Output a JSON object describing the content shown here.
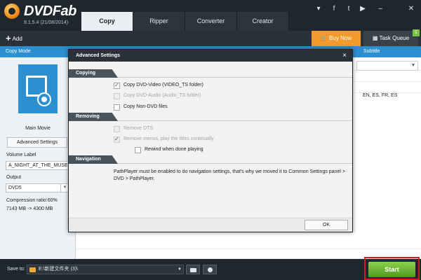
{
  "app": {
    "logo_text": "DVDFab",
    "version": "9.1.5.4 (21/08/2014)"
  },
  "window_icons": [
    "dropdown-icon",
    "facebook-icon",
    "twitter-icon",
    "youtube-icon",
    "minimize-icon",
    "close-icon"
  ],
  "tabs": [
    {
      "label": "Copy",
      "active": true
    },
    {
      "label": "Ripper",
      "active": false
    },
    {
      "label": "Converter",
      "active": false
    },
    {
      "label": "Creator",
      "active": false
    }
  ],
  "toolbar": {
    "add_label": "Add",
    "buy_now_label": "Buy Now",
    "task_queue_label": "Task Queue",
    "task_queue_count": "1"
  },
  "header": {
    "copy_mode_label": "Copy Mode",
    "subtitle_label": "Subtitle"
  },
  "left_panel": {
    "mode_name": "Main Movie",
    "advanced_settings_label": "Advanced Settings",
    "volume_label_title": "Volume Label",
    "volume_label_value": "A_NIGHT_AT_THE_MUSE",
    "output_title": "Output",
    "output_value": "DVD5",
    "compression_ratio": "Compression ratio:60%",
    "size_info": "7143 MB -> 4300 MB"
  },
  "content": {
    "subtitle_value": "EN, ES, FR, ES"
  },
  "bottom": {
    "save_to_label": "Save to:",
    "save_to_path": "E:\\新建文件夹 (3)\\",
    "start_label": "Start"
  },
  "modal": {
    "title": "Advanced Settings",
    "close_label": "×",
    "sections": {
      "copying": "Copying",
      "removing": "Removing",
      "navigation": "Navigation"
    },
    "copying_options": [
      {
        "label": "Copy DVD-Video (VIDEO_TS folder)",
        "checked": true,
        "enabled": true
      },
      {
        "label": "Copy DVD-Audio (Audio_TS folder)",
        "checked": false,
        "enabled": false
      },
      {
        "label": "Copy Non-DVD files",
        "checked": false,
        "enabled": true
      }
    ],
    "removing_options": [
      {
        "label": "Remove DTS",
        "checked": false,
        "enabled": false
      },
      {
        "label": "Remove menus, play the titles continually",
        "checked": true,
        "enabled": false
      },
      {
        "label": "Rewind when done playing",
        "checked": false,
        "enabled": true
      }
    ],
    "navigation_text": "PathPlayer must be enabled to do navigation settings, that's why we moved it to Common Settings panel > DVD > PathPlayer.",
    "ok_label": "OK"
  }
}
